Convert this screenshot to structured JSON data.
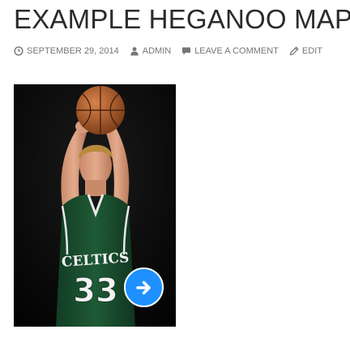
{
  "post": {
    "title": "EXAMPLE HEGANOO MAP",
    "meta": {
      "date": "SEPTEMBER 29, 2014",
      "author": "ADMIN",
      "comments": "LEAVE A COMMENT",
      "edit": "EDIT"
    },
    "icons": {
      "date": "clock-icon",
      "author": "user-icon",
      "comments": "comment-icon",
      "edit": "pencil-icon",
      "next": "arrow-right-icon"
    }
  },
  "photo": {
    "jersey_team": "CELTICS",
    "jersey_number": "33"
  },
  "colors": {
    "accent": "#1e90ff",
    "meta_text": "#767676",
    "title_text": "#2b2b2b",
    "jersey_green": "#1f5a36"
  }
}
